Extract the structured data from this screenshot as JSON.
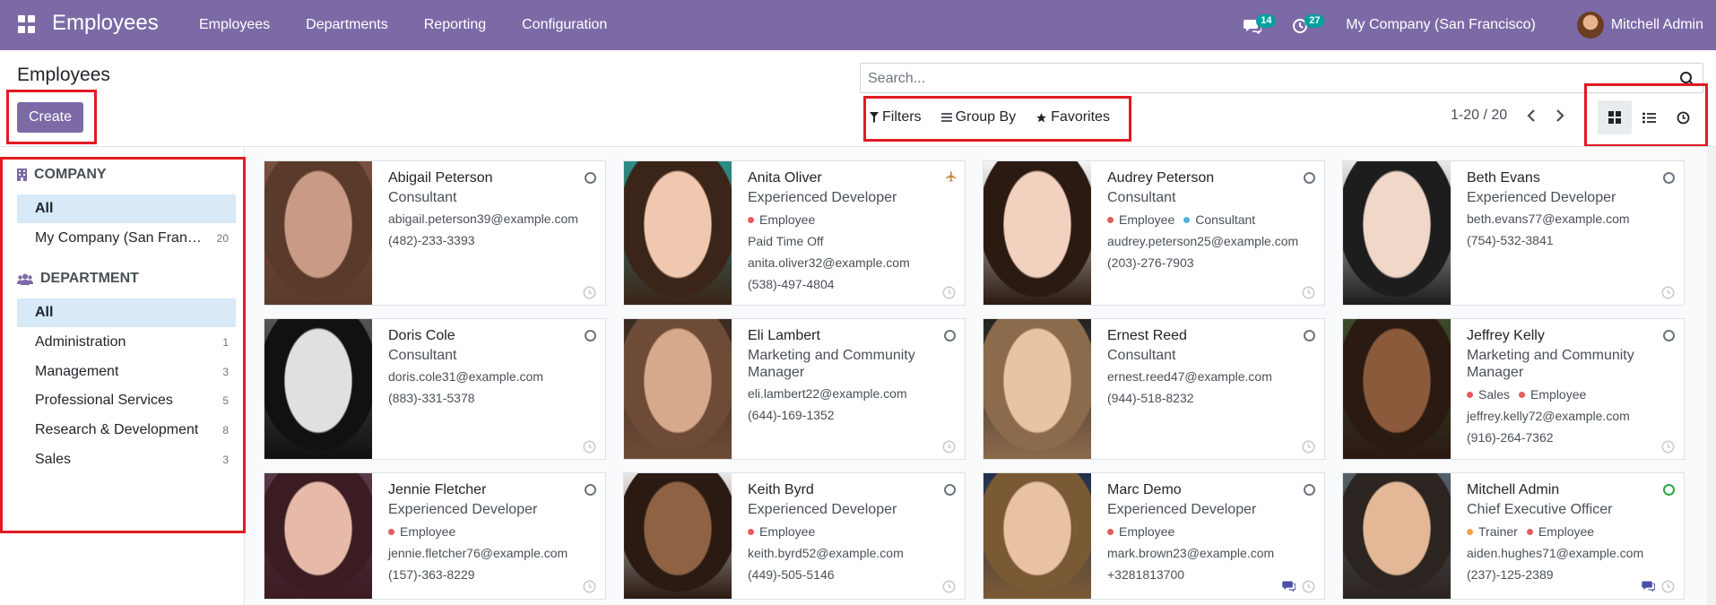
{
  "app": {
    "title": "Employees"
  },
  "menu": [
    {
      "label": "Employees"
    },
    {
      "label": "Departments"
    },
    {
      "label": "Reporting"
    },
    {
      "label": "Configuration"
    }
  ],
  "systray": {
    "messages_count": "14",
    "activities_count": "27",
    "company": "My Company (San Francisco)",
    "user": "Mitchell Admin"
  },
  "page": {
    "title": "Employees",
    "create_label": "Create"
  },
  "search": {
    "placeholder": "Search..."
  },
  "filters": {
    "filters_label": "Filters",
    "group_by_label": "Group By",
    "favorites_label": "Favorites"
  },
  "pager": {
    "text": "1-20 / 20"
  },
  "views": {
    "active": "kanban"
  },
  "sidebar": {
    "company_header": "COMPANY",
    "company_items": [
      {
        "label": "All",
        "count": ""
      },
      {
        "label": "My Company (San Francisco)",
        "count": "20"
      }
    ],
    "department_header": "DEPARTMENT",
    "department_items": [
      {
        "label": "All",
        "count": ""
      },
      {
        "label": "Administration",
        "count": "1"
      },
      {
        "label": "Management",
        "count": "3"
      },
      {
        "label": "Professional Services",
        "count": "5"
      },
      {
        "label": "Research & Development",
        "count": "8"
      },
      {
        "label": "Sales",
        "count": "3"
      }
    ]
  },
  "employees": [
    {
      "name": "Abigail Peterson",
      "job": "Consultant",
      "tags": [],
      "lines": [
        "abigail.peterson39@example.com",
        "(482)-233-3393"
      ],
      "status": "offline"
    },
    {
      "name": "Anita Oliver",
      "job": "Experienced Developer",
      "tags": [
        {
          "label": "Employee",
          "color": "#e45b5b"
        }
      ],
      "lines": [
        "Paid Time Off",
        "anita.oliver32@example.com",
        "(538)-497-4804"
      ],
      "status": "leave"
    },
    {
      "name": "Audrey Peterson",
      "job": "Consultant",
      "tags": [
        {
          "label": "Employee",
          "color": "#e45b5b"
        },
        {
          "label": "Consultant",
          "color": "#4cb3e3"
        }
      ],
      "lines": [
        "audrey.peterson25@example.com",
        "(203)-276-7903"
      ],
      "status": "offline"
    },
    {
      "name": "Beth Evans",
      "job": "Experienced Developer",
      "tags": [],
      "lines": [
        "beth.evans77@example.com",
        "(754)-532-3841"
      ],
      "status": "offline"
    },
    {
      "name": "Doris Cole",
      "job": "Consultant",
      "tags": [],
      "lines": [
        "doris.cole31@example.com",
        "(883)-331-5378"
      ],
      "status": "offline"
    },
    {
      "name": "Eli Lambert",
      "job": "Marketing and Community Manager",
      "tags": [],
      "lines": [
        "eli.lambert22@example.com",
        "(644)-169-1352"
      ],
      "status": "offline"
    },
    {
      "name": "Ernest Reed",
      "job": "Consultant",
      "tags": [],
      "lines": [
        "ernest.reed47@example.com",
        "(944)-518-8232"
      ],
      "status": "offline"
    },
    {
      "name": "Jeffrey Kelly",
      "job": "Marketing and Community Manager",
      "tags": [
        {
          "label": "Sales",
          "color": "#e45b5b"
        },
        {
          "label": "Employee",
          "color": "#e45b5b"
        }
      ],
      "lines": [
        "jeffrey.kelly72@example.com",
        "(916)-264-7362"
      ],
      "status": "offline"
    },
    {
      "name": "Jennie Fletcher",
      "job": "Experienced Developer",
      "tags": [
        {
          "label": "Employee",
          "color": "#e45b5b"
        }
      ],
      "lines": [
        "jennie.fletcher76@example.com",
        "(157)-363-8229"
      ],
      "status": "offline"
    },
    {
      "name": "Keith Byrd",
      "job": "Experienced Developer",
      "tags": [
        {
          "label": "Employee",
          "color": "#e45b5b"
        }
      ],
      "lines": [
        "keith.byrd52@example.com",
        "(449)-505-5146"
      ],
      "status": "offline"
    },
    {
      "name": "Marc Demo",
      "job": "Experienced Developer",
      "tags": [
        {
          "label": "Employee",
          "color": "#e45b5b"
        }
      ],
      "lines": [
        "mark.brown23@example.com",
        "+3281813700"
      ],
      "status": "offline"
    },
    {
      "name": "Mitchell Admin",
      "job": "Chief Executive Officer",
      "tags": [
        {
          "label": "Trainer",
          "color": "#f0a24a"
        },
        {
          "label": "Employee",
          "color": "#e45b5b"
        }
      ],
      "lines": [
        "aiden.hughes71@example.com",
        "(237)-125-2389"
      ],
      "status": "online"
    }
  ],
  "colors": {
    "brand": "#7c6aa7",
    "badge": "#00a09d",
    "highlight": "#e11a22",
    "active_filter": "#d8e9f7"
  }
}
